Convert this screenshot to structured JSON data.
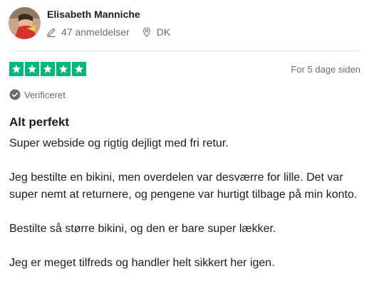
{
  "reviewer": {
    "name": "Elisabeth Manniche",
    "review_count": "47 anmeldelser",
    "country": "DK"
  },
  "rating": {
    "stars": 5,
    "max_stars": 5,
    "star_color": "#00b67a"
  },
  "date": "For 5 dage siden",
  "verified_label": "Verificeret",
  "review": {
    "title": "Alt perfekt",
    "paragraphs": [
      "Super webside og rigtig dejligt med fri retur.",
      "Jeg bestilte en bikini, men overdelen var desværre for lille. Det var super nemt at returnere, og pengene var hurtigt tilbage på min konto.",
      "Bestilte så større bikini, og den er bare super lækker.",
      "Jeg er meget tilfreds og handler helt sikkert her igen."
    ]
  },
  "icons": {
    "review_count": "pencil-icon",
    "country": "location-pin-icon",
    "verified": "checkmark-circle-icon",
    "star": "star-icon"
  }
}
